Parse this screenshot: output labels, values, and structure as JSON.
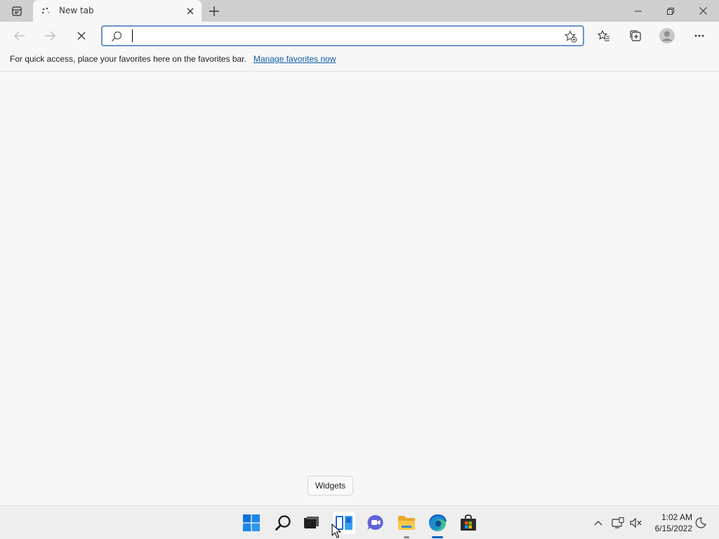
{
  "browser": {
    "tab": {
      "title": "New tab"
    },
    "address_bar": {
      "value": "",
      "placeholder": ""
    },
    "favorites_bar": {
      "message": "For quick access, place your favorites here on the favorites bar.",
      "link": "Manage favorites now"
    }
  },
  "tooltip": {
    "text": "Widgets"
  },
  "taskbar": {
    "apps": [
      {
        "name": "start"
      },
      {
        "name": "search"
      },
      {
        "name": "task-view"
      },
      {
        "name": "widgets"
      },
      {
        "name": "chat"
      },
      {
        "name": "file-explorer"
      },
      {
        "name": "edge"
      },
      {
        "name": "store"
      }
    ],
    "clock": {
      "time": "1:02 AM",
      "date": "6/15/2022"
    }
  },
  "colors": {
    "accent": "#0067c0",
    "link": "#0f5ca8",
    "address_border": "#6b93c9"
  }
}
